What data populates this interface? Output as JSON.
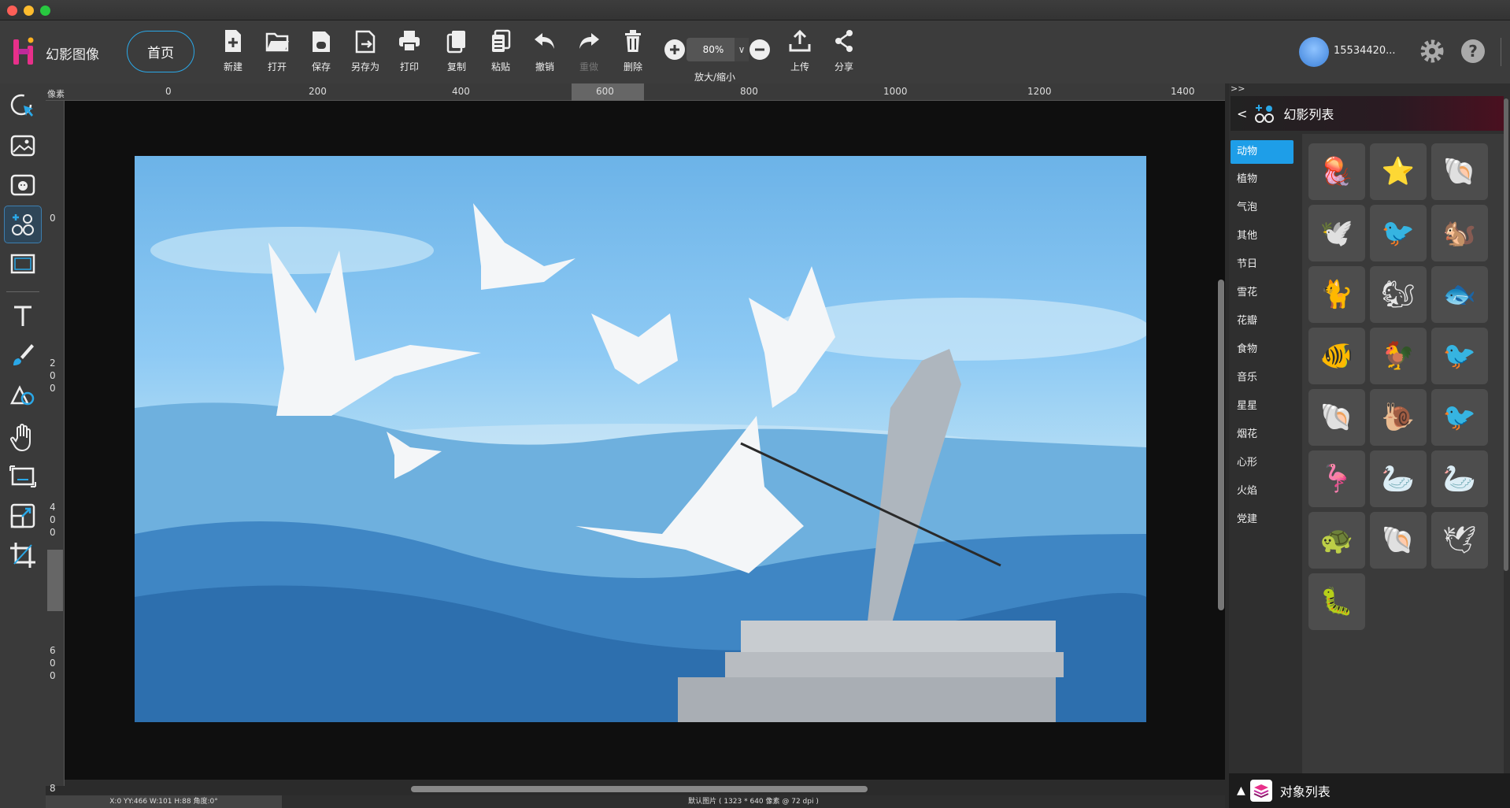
{
  "app": {
    "name": "幻影图像",
    "home_label": "首页"
  },
  "toolbar": {
    "new": "新建",
    "open": "打开",
    "save": "保存",
    "save_as": "另存为",
    "print": "打印",
    "copy": "复制",
    "paste": "粘贴",
    "undo": "撤销",
    "redo": "重做",
    "delete": "删除",
    "zoom_label": "放大/缩小",
    "zoom_value": "80%",
    "upload": "上传",
    "share": "分享"
  },
  "user": {
    "name": "15534420..."
  },
  "ruler": {
    "unit": "像素",
    "top_ticks": [
      "0",
      "200",
      "400",
      "600",
      "800",
      "1000",
      "1200",
      "1400"
    ],
    "left_ticks": [
      "0",
      "200",
      "400",
      "600",
      "8"
    ]
  },
  "status": {
    "coords": "X:0  YY:466  W:101  H:88  角度:0°",
    "image_info": "默认图片 ( 1323 * 640 像素 @ 72 dpi )"
  },
  "panel": {
    "collapse": ">>",
    "back": "<",
    "title": "幻影列表",
    "categories": [
      "动物",
      "植物",
      "气泡",
      "其他",
      "节日",
      "雪花",
      "花瓣",
      "食物",
      "音乐",
      "星星",
      "烟花",
      "心形",
      "火焰",
      "党建"
    ],
    "thumbnails": [
      "🪼",
      "⭐",
      "🐚",
      "🕊️",
      "🐦",
      "🐿️",
      "🐈",
      "🐿",
      "🐟",
      "🐠",
      "🐓",
      "🐦",
      "🐚",
      "🐌",
      "🐦",
      "🦩",
      "🦢",
      "🦢",
      "🐢",
      "🐚",
      "🕊",
      "🐛"
    ]
  },
  "objects_panel": {
    "title": "对象列表"
  },
  "colors": {
    "accent": "#1e9ee8",
    "logo": "#e8308a"
  }
}
